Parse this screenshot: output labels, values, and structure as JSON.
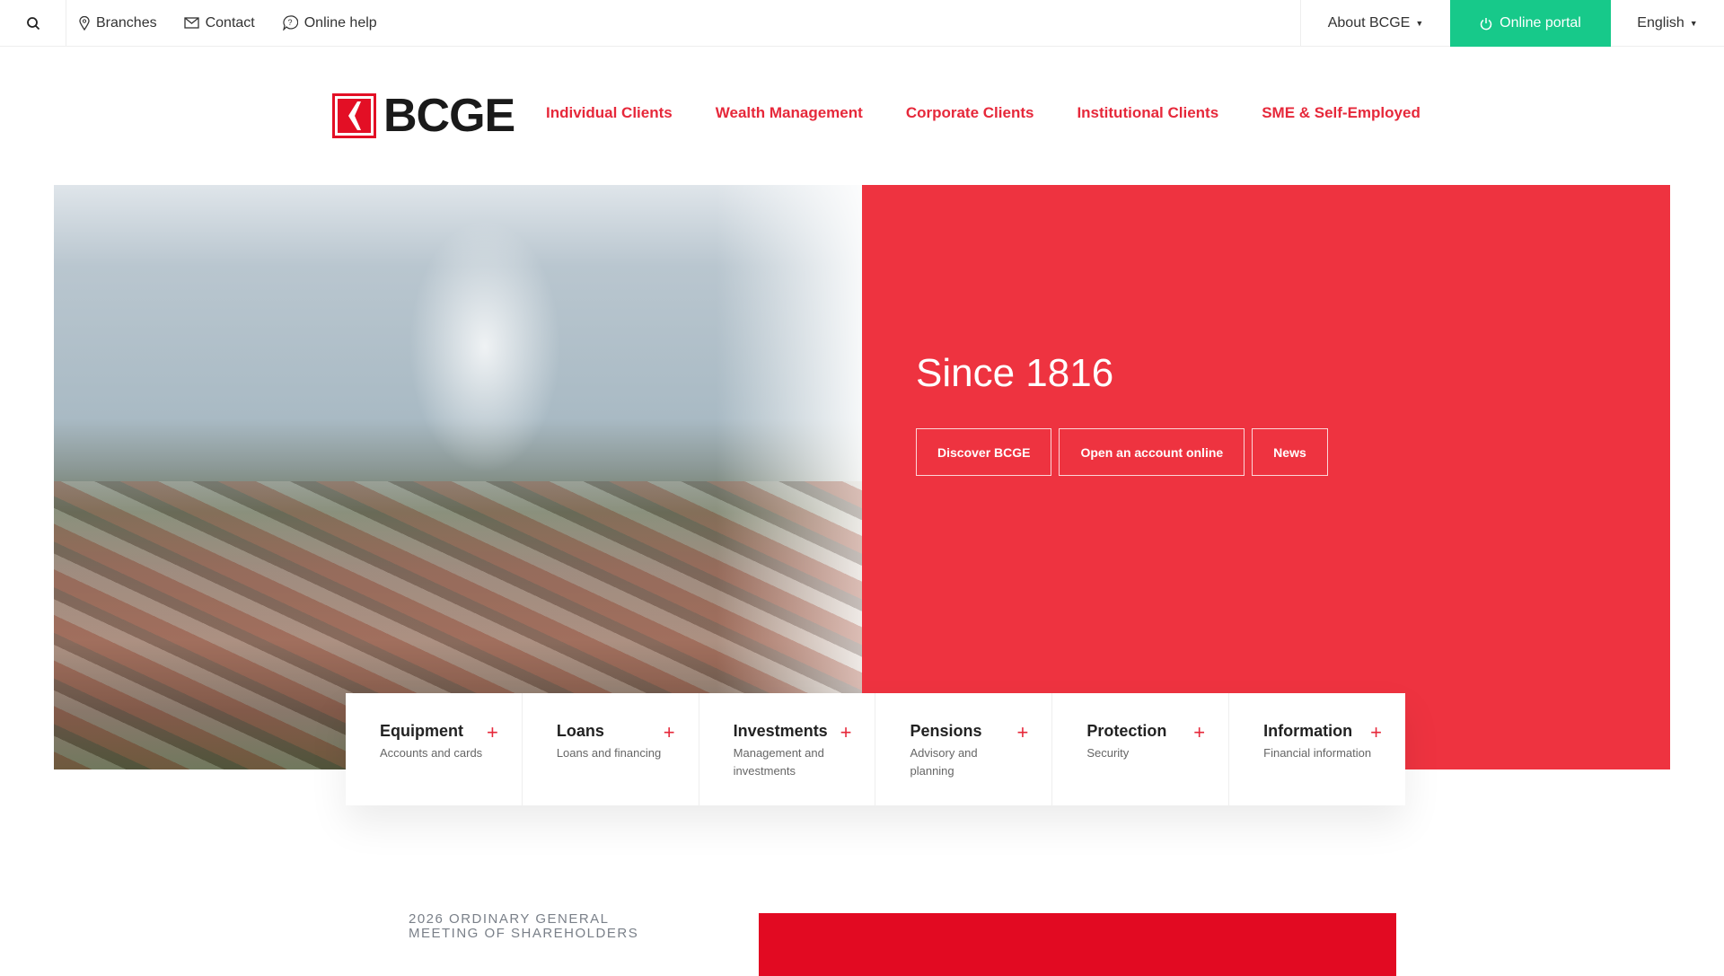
{
  "topbar": {
    "branches": "Branches",
    "contact": "Contact",
    "online_help": "Online help",
    "about": "About BCGE",
    "online_portal": "Online portal",
    "language": "English"
  },
  "logo": {
    "text": "BCGE"
  },
  "nav": [
    "Individual Clients",
    "Wealth Management",
    "Corporate Clients",
    "Institutional Clients",
    "SME & Self-Employed"
  ],
  "hero": {
    "title": "Since 1816",
    "buttons": [
      "Discover BCGE",
      "Open an account online",
      "News"
    ]
  },
  "cards": [
    {
      "title": "Equipment",
      "subtitle": "Accounts and cards"
    },
    {
      "title": "Loans",
      "subtitle": "Loans and financing"
    },
    {
      "title": "Investments",
      "subtitle": "Management and investments"
    },
    {
      "title": "Pensions",
      "subtitle": "Advisory and planning"
    },
    {
      "title": "Protection",
      "subtitle": "Security"
    },
    {
      "title": "Information",
      "subtitle": "Financial information"
    }
  ],
  "news": {
    "heading": "2026 ORDINARY GENERAL MEETING OF SHAREHOLDERS"
  },
  "colors": {
    "brand_red": "#e6283a",
    "hero_red": "#ee3340",
    "portal_green": "#17c98a"
  }
}
